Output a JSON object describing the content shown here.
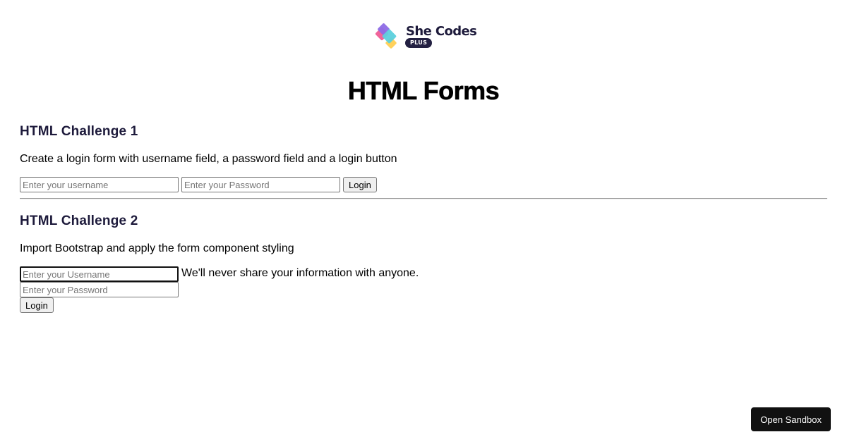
{
  "logo": {
    "brand_name": "She Codes",
    "badge": "PLUS",
    "colors": {
      "pink": "#f0649a",
      "purple": "#8d6be6",
      "teal": "#5cd0dd",
      "yellow": "#ffd15c",
      "navy": "#1d1a3b"
    }
  },
  "page_title": "HTML Forms",
  "challenge1": {
    "title": "HTML Challenge 1",
    "description": "Create a login form with username field, a password field and a login button",
    "username_placeholder": "Enter your username",
    "password_placeholder": "Enter your Password",
    "login_label": "Login"
  },
  "challenge2": {
    "title": "HTML Challenge 2",
    "description": "Import Bootstrap and apply the form component styling",
    "username_placeholder": "Enter your Username",
    "helper_text": "We'll never share your information with anyone.",
    "password_placeholder": "Enter your Password",
    "login_label": "Login"
  },
  "sandbox": {
    "label": "Open Sandbox"
  }
}
